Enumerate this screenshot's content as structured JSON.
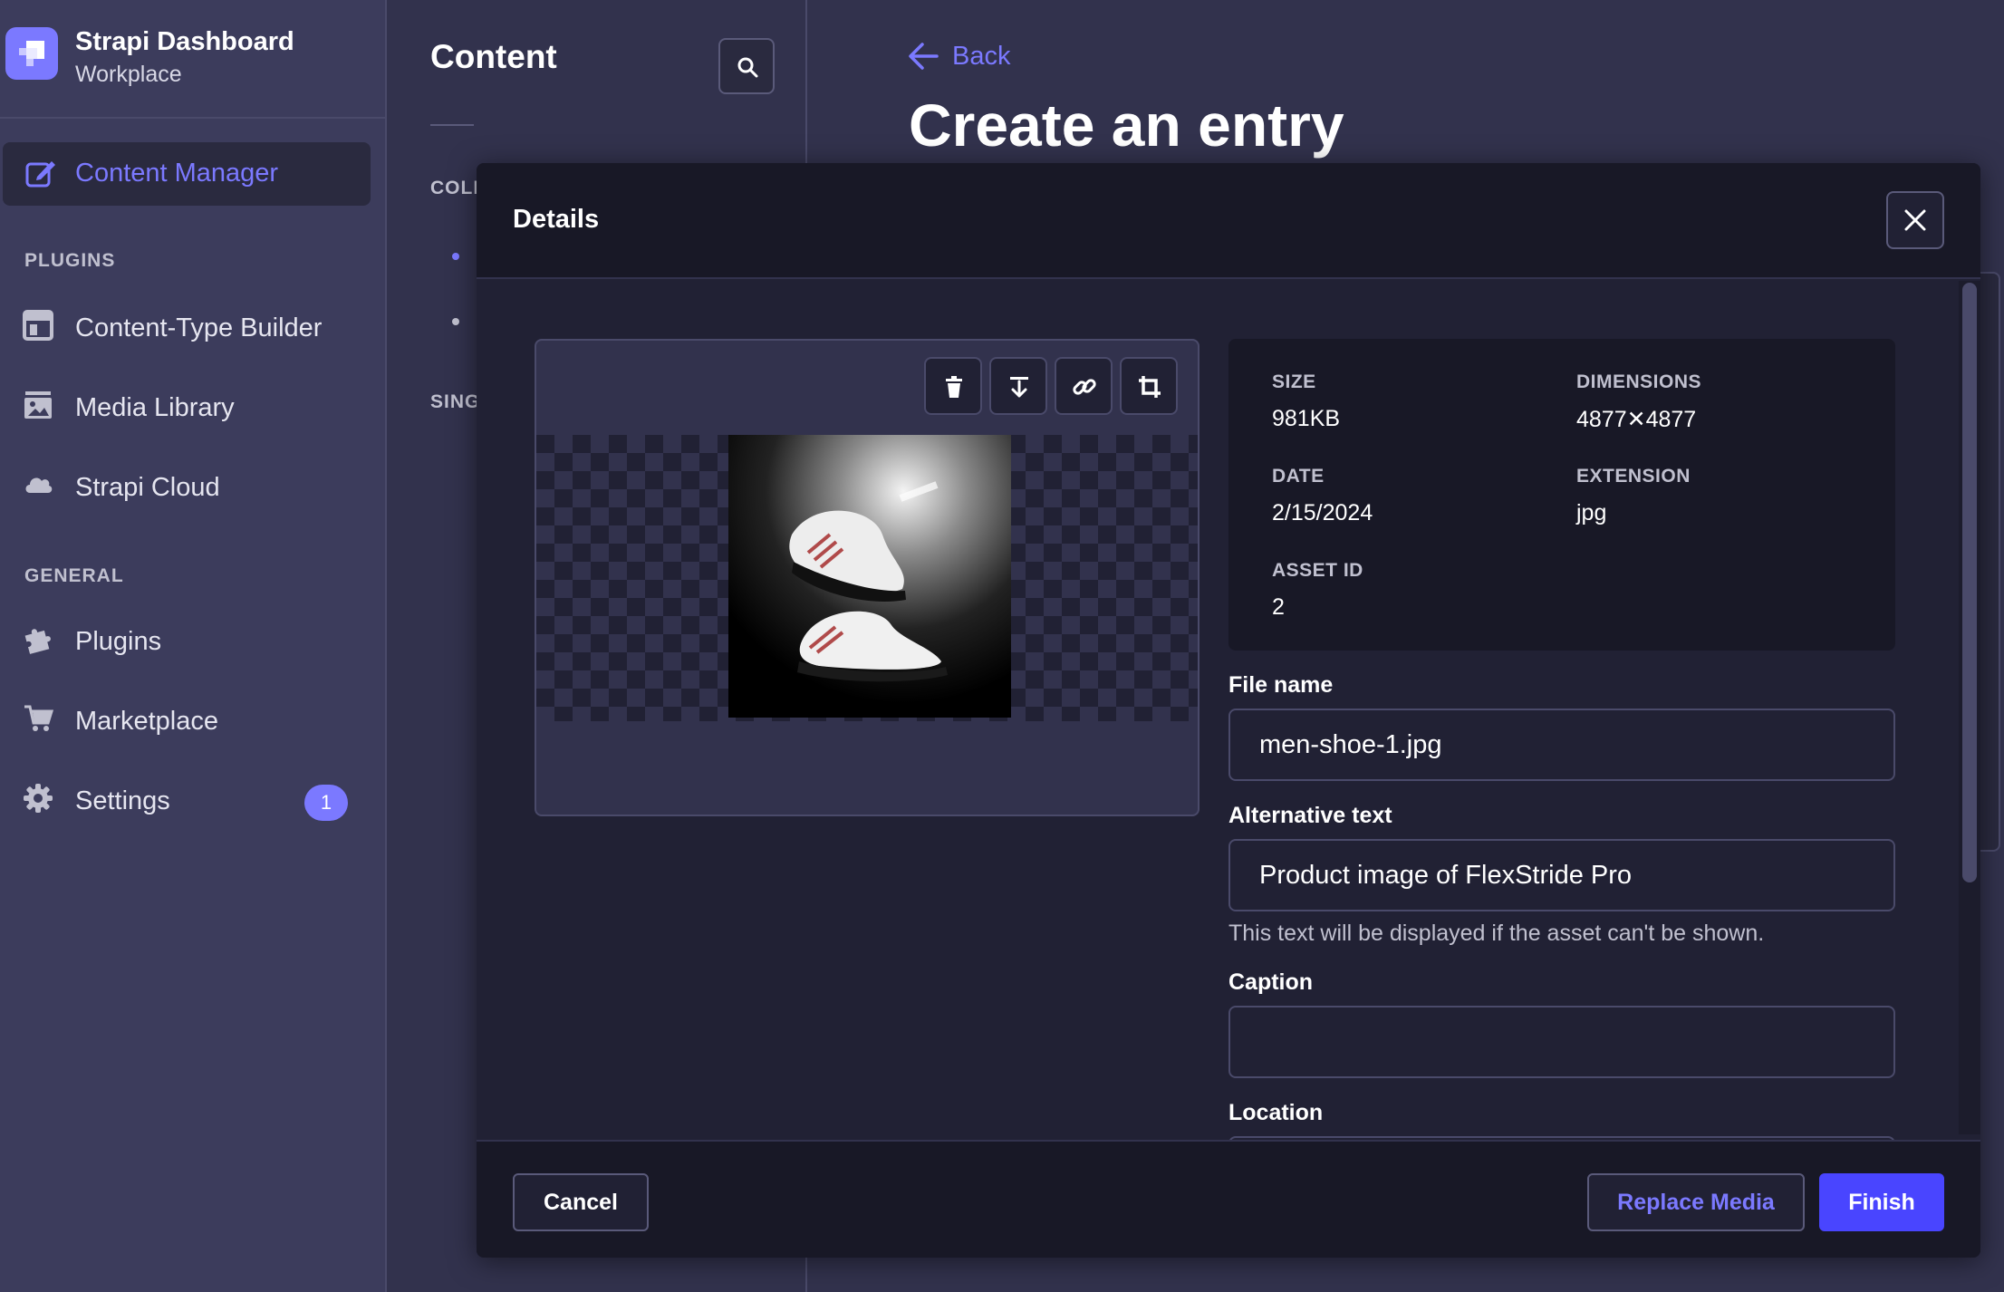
{
  "brand": {
    "title": "Strapi Dashboard",
    "subtitle": "Workplace",
    "logo_icon": "strapi-logo-icon"
  },
  "mainnav": {
    "active_item": {
      "label": "Content Manager",
      "icon": "content-manager-icon"
    },
    "plugins_heading": "PLUGINS",
    "plugins": [
      {
        "label": "Content-Type Builder",
        "icon": "layout-icon"
      },
      {
        "label": "Media Library",
        "icon": "image-icon"
      },
      {
        "label": "Strapi Cloud",
        "icon": "cloud-icon"
      }
    ],
    "general_heading": "GENERAL",
    "general": [
      {
        "label": "Plugins",
        "icon": "puzzle-icon"
      },
      {
        "label": "Marketplace",
        "icon": "cart-icon"
      },
      {
        "label": "Settings",
        "icon": "gear-icon",
        "badge": "1"
      }
    ]
  },
  "subnav": {
    "title": "Content",
    "search_icon": "search-icon",
    "collection_heading_visible": "COLL",
    "single_heading_visible": "SING"
  },
  "header": {
    "back_label": "Back",
    "title": "Create an entry"
  },
  "modal": {
    "title": "Details",
    "toolbar": [
      "trash-icon",
      "download-icon",
      "link-icon",
      "crop-icon"
    ],
    "image_alt": "men-shoe-1.jpg preview",
    "details": {
      "size_label": "SIZE",
      "size_value": "981KB",
      "dimensions_label": "DIMENSIONS",
      "dimensions_value": "4877✕4877",
      "date_label": "DATE",
      "date_value": "2/15/2024",
      "extension_label": "EXTENSION",
      "extension_value": "jpg",
      "asset_id_label": "ASSET ID",
      "asset_id_value": "2"
    },
    "fields": {
      "file_name_label": "File name",
      "file_name_value": "men-shoe-1.jpg",
      "alt_label": "Alternative text",
      "alt_value": "Product image of FlexStride Pro",
      "alt_hint": "This text will be displayed if the asset can't be shown.",
      "caption_label": "Caption",
      "caption_value": "",
      "location_label": "Location"
    },
    "footer": {
      "cancel": "Cancel",
      "replace": "Replace Media",
      "finish": "Finish"
    }
  },
  "colors": {
    "accent": "#7b79ff",
    "primary_button": "#4945ff",
    "background": "#32324d",
    "modal": "#212134"
  }
}
